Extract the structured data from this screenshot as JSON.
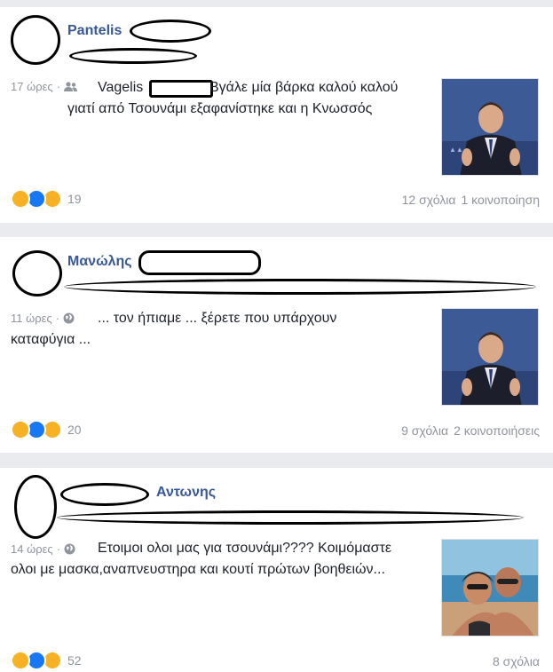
{
  "posts": [
    {
      "author": "Pantelis",
      "time": "17 ώρες",
      "separator": "·",
      "audience_icon": "friends-icon",
      "text_line1_a": "Vagelis",
      "text_line1_b": "Βγάλε μία βάρκα καλού καλού",
      "text_line2": "γιατί από Τσουνάμι εξαφανίστηκε και η Κνωσσός",
      "reaction_count": "19",
      "comments": "12 σχόλια",
      "shares": "1 κοινοποίηση"
    },
    {
      "author": "Μανώλης",
      "time": "11 ώρες",
      "separator": "·",
      "audience_icon": "globe-icon",
      "text_line1": "... τον ήπιαμε ... ξέρετε που υπάρχουν",
      "text_line2": "καταφύγια ...",
      "reaction_count": "20",
      "comments": "9 σχόλια",
      "shares": "2 κοινοποιήσεις"
    },
    {
      "author": "Αντωνης",
      "time": "14 ώρες",
      "separator": "·",
      "audience_icon": "globe-icon",
      "text_line1": "Ετοιμοι ολοι μας για τσουνάμι???? Κοιμόμαστε",
      "text_line2": "ολοι με μασκα,αναπνευστηρα και κουτί πρώτων βοηθειών...",
      "reaction_count": "52",
      "comments": "8 σχόλια"
    }
  ],
  "colors": {
    "link": "#385898",
    "meta": "#90949c",
    "haha": "#f7b125",
    "like": "#1877f2"
  }
}
